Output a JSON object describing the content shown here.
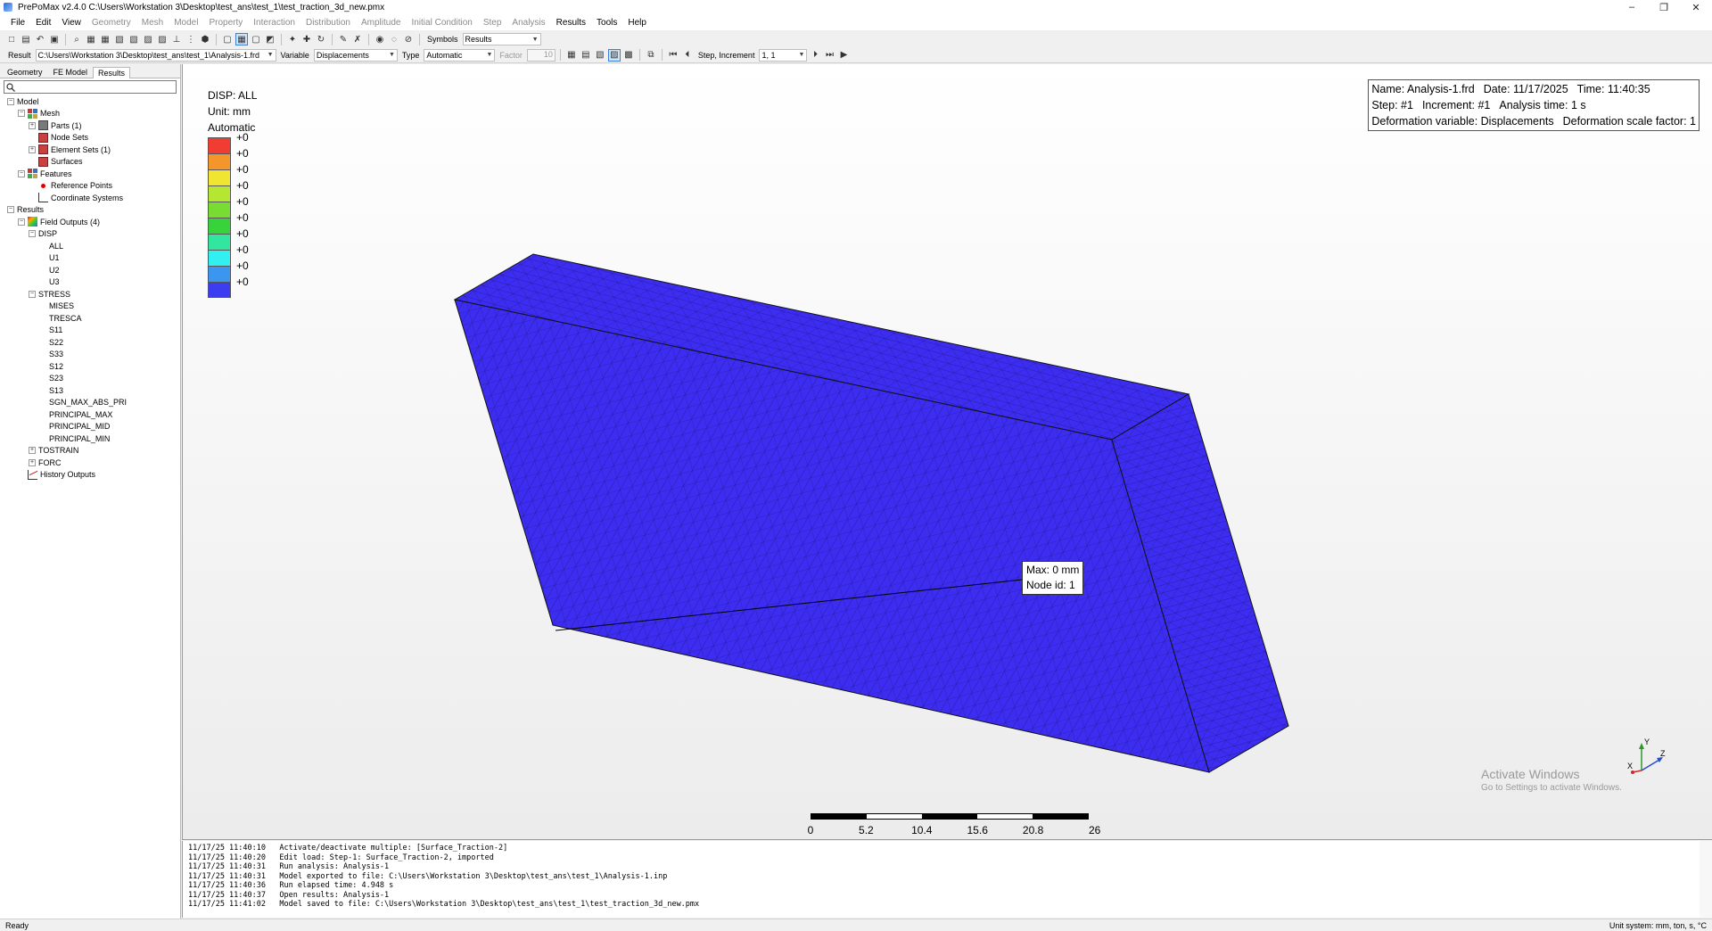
{
  "window": {
    "title": "PrePoMax v2.4.0  C:\\Users\\Workstation 3\\Desktop\\test_ans\\test_1\\test_traction_3d_new.pmx",
    "controls": [
      "–",
      "❐",
      "✕"
    ]
  },
  "menu": {
    "items": [
      {
        "label": "File",
        "enabled": true
      },
      {
        "label": "Edit",
        "enabled": true
      },
      {
        "label": "View",
        "enabled": true
      },
      {
        "label": "Geometry",
        "enabled": false
      },
      {
        "label": "Mesh",
        "enabled": false
      },
      {
        "label": "Model",
        "enabled": false
      },
      {
        "label": "Property",
        "enabled": false
      },
      {
        "label": "Interaction",
        "enabled": false
      },
      {
        "label": "Distribution",
        "enabled": false
      },
      {
        "label": "Amplitude",
        "enabled": false
      },
      {
        "label": "Initial Condition",
        "enabled": false
      },
      {
        "label": "Step",
        "enabled": false
      },
      {
        "label": "Analysis",
        "enabled": false
      },
      {
        "label": "Results",
        "enabled": true
      },
      {
        "label": "Tools",
        "enabled": true
      },
      {
        "label": "Help",
        "enabled": true
      }
    ]
  },
  "toolbar1": {
    "symbols_label": "Symbols",
    "symbols_value": "Results"
  },
  "toolbar2": {
    "result_label": "Result",
    "result_value": "C:\\Users\\Workstation 3\\Desktop\\test_ans\\test_1\\Analysis-1.frd",
    "variable_label": "Variable",
    "variable_value": "Displacements",
    "type_label": "Type",
    "type_value": "Automatic",
    "factor_label": "Factor",
    "factor_value": "10",
    "step_label": "Step, Increment",
    "step_value": "1, 1"
  },
  "left_panel": {
    "tabs": [
      {
        "label": "Geometry",
        "active": false
      },
      {
        "label": "FE Model",
        "active": false
      },
      {
        "label": "Results",
        "active": true
      }
    ],
    "search_placeholder": "",
    "tree": [
      {
        "label": "Model",
        "level": 0,
        "exp": "-",
        "icon": ""
      },
      {
        "label": "Mesh",
        "level": 1,
        "exp": "-",
        "icon": "mesh"
      },
      {
        "label": "Parts (1)",
        "level": 2,
        "exp": "+",
        "icon": "part"
      },
      {
        "label": "Node Sets",
        "level": 2,
        "exp": "",
        "icon": "set"
      },
      {
        "label": "Element Sets (1)",
        "level": 2,
        "exp": "+",
        "icon": "set"
      },
      {
        "label": "Surfaces",
        "level": 2,
        "exp": "",
        "icon": "set"
      },
      {
        "label": "Features",
        "level": 1,
        "exp": "-",
        "icon": "mesh"
      },
      {
        "label": "Reference Points",
        "level": 2,
        "exp": "",
        "icon": "point"
      },
      {
        "label": "Coordinate Systems",
        "level": 2,
        "exp": "",
        "icon": "cs"
      },
      {
        "label": "Results",
        "level": 0,
        "exp": "-",
        "icon": ""
      },
      {
        "label": "Field Outputs (4)",
        "level": 1,
        "exp": "-",
        "icon": "field"
      },
      {
        "label": "DISP",
        "level": 2,
        "exp": "-",
        "icon": ""
      },
      {
        "label": "ALL",
        "level": 3,
        "exp": "",
        "icon": ""
      },
      {
        "label": "U1",
        "level": 3,
        "exp": "",
        "icon": ""
      },
      {
        "label": "U2",
        "level": 3,
        "exp": "",
        "icon": ""
      },
      {
        "label": "U3",
        "level": 3,
        "exp": "",
        "icon": ""
      },
      {
        "label": "STRESS",
        "level": 2,
        "exp": "-",
        "icon": ""
      },
      {
        "label": "MISES",
        "level": 3,
        "exp": "",
        "icon": ""
      },
      {
        "label": "TRESCA",
        "level": 3,
        "exp": "",
        "icon": ""
      },
      {
        "label": "S11",
        "level": 3,
        "exp": "",
        "icon": ""
      },
      {
        "label": "S22",
        "level": 3,
        "exp": "",
        "icon": ""
      },
      {
        "label": "S33",
        "level": 3,
        "exp": "",
        "icon": ""
      },
      {
        "label": "S12",
        "level": 3,
        "exp": "",
        "icon": ""
      },
      {
        "label": "S23",
        "level": 3,
        "exp": "",
        "icon": ""
      },
      {
        "label": "S13",
        "level": 3,
        "exp": "",
        "icon": ""
      },
      {
        "label": "SGN_MAX_ABS_PRI",
        "level": 3,
        "exp": "",
        "icon": ""
      },
      {
        "label": "PRINCIPAL_MAX",
        "level": 3,
        "exp": "",
        "icon": ""
      },
      {
        "label": "PRINCIPAL_MID",
        "level": 3,
        "exp": "",
        "icon": ""
      },
      {
        "label": "PRINCIPAL_MIN",
        "level": 3,
        "exp": "",
        "icon": ""
      },
      {
        "label": "TOSTRAIN",
        "level": 2,
        "exp": "+",
        "icon": ""
      },
      {
        "label": "FORC",
        "level": 2,
        "exp": "+",
        "icon": ""
      },
      {
        "label": "History Outputs",
        "level": 1,
        "exp": "",
        "icon": "hist"
      }
    ]
  },
  "legend": {
    "title": "DISP: ALL",
    "unit": "Unit: mm",
    "mode": "Automatic",
    "colors": [
      "#f03c32",
      "#f5962d",
      "#f0e632",
      "#b4e632",
      "#78dc32",
      "#37d23c",
      "#32e6a0",
      "#32f0f0",
      "#3c96f0",
      "#3c3cf0"
    ],
    "values": [
      "+0",
      "+0",
      "+0",
      "+0",
      "+0",
      "+0",
      "+0",
      "+0",
      "+0",
      "+0"
    ]
  },
  "info": {
    "name": "Name: Analysis-1.frd",
    "date": "Date: 11/17/2025",
    "time": "Time: 11:40:35",
    "step": "Step: #1",
    "increment": "Increment: #1",
    "analysis_time": "Analysis time: 1 s",
    "def_var": "Deformation variable: Displacements",
    "def_scale": "Deformation scale factor: 1"
  },
  "probe": {
    "max": "Max: 0 mm",
    "node": "Node id: 1"
  },
  "scale_bar": {
    "ticks": [
      "0",
      "5.2",
      "10.4",
      "15.6",
      "20.8",
      "26 mm"
    ]
  },
  "triad": {
    "x": "X",
    "y": "Y",
    "z": "Z"
  },
  "model_color": "#3c2df0",
  "watermark": {
    "line1": "Activate Windows",
    "line2": "Go to Settings to activate Windows."
  },
  "log": {
    "lines": [
      "11/17/25 11:40:10   Activate/deactivate multiple: [Surface_Traction-2]",
      "11/17/25 11:40:20   Edit load: Step-1: Surface_Traction-2, imported",
      "11/17/25 11:40:31   Run analysis: Analysis-1",
      "11/17/25 11:40:31   Model exported to file: C:\\Users\\Workstation 3\\Desktop\\test_ans\\test_1\\Analysis-1.inp",
      "11/17/25 11:40:36   Run elapsed time: 4.948 s",
      "11/17/25 11:40:37   Open results: Analysis-1",
      "11/17/25 11:41:02   Model saved to file: C:\\Users\\Workstation 3\\Desktop\\test_ans\\test_1\\test_traction_3d_new.pmx"
    ]
  },
  "status": {
    "left": "Ready",
    "right": "Unit system: mm, ton, s, °C"
  }
}
